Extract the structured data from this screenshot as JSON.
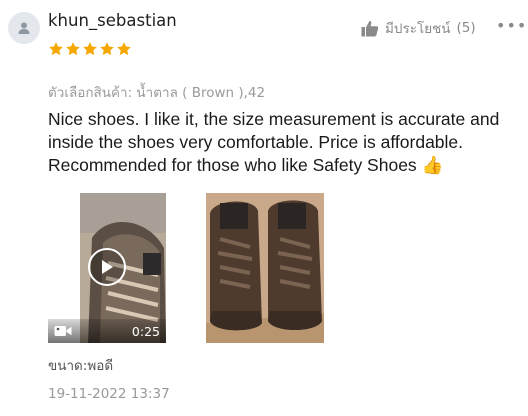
{
  "review": {
    "username": "khun_sebastian",
    "rating": 5,
    "helpful_label": "มีประโยชน์",
    "helpful_count": "(5)",
    "variant": "ตัวเลือกสินค้า: น้ำตาล ( Brown ),42",
    "text": "Nice shoes. I like it, the size measurement is accurate and inside the shoes very comfortable. Price is affordable. Recommended for those who like Safety Shoes 👍",
    "video_duration": "0:25",
    "size_label": "ขนาด:พอดี",
    "date": "19-11-2022 13:37"
  },
  "icons": {
    "avatar": "user-icon",
    "helpful": "thumbs-up-icon",
    "more": "more-options-icon",
    "star": "star-icon",
    "play": "play-icon",
    "video": "video-camera-icon"
  },
  "colors": {
    "star": "#f6a700",
    "muted": "#9a9a9a",
    "text": "#1a1a1a"
  }
}
